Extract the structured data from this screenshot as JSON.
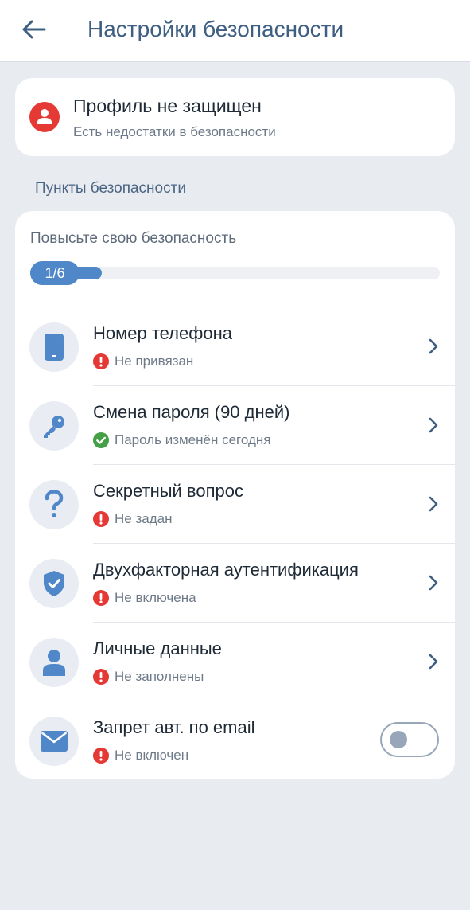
{
  "header": {
    "title": "Настройки безопасности",
    "back_icon": "arrow-left-icon"
  },
  "status_card": {
    "title": "Профиль не защищен",
    "subtitle": "Есть недостатки в безопасности",
    "icon": "user-alert-icon",
    "color": "#e53935"
  },
  "section": {
    "title": "Пункты безопасности"
  },
  "progress": {
    "caption": "Повысьте свою безопасность",
    "label": "1/6",
    "completed": 1,
    "total": 6
  },
  "items": [
    {
      "title": "Номер телефона",
      "status": "Не привязан",
      "state": "error",
      "icon": "phone-icon",
      "control": "chevron"
    },
    {
      "title": "Смена пароля (90 дней)",
      "status": "Пароль изменён сегодня",
      "state": "ok",
      "icon": "key-icon",
      "control": "chevron"
    },
    {
      "title": "Секретный вопрос",
      "status": "Не задан",
      "state": "error",
      "icon": "question-icon",
      "control": "chevron"
    },
    {
      "title": "Двухфакторная аутентификация",
      "status": "Не включена",
      "state": "error",
      "icon": "shield-check-icon",
      "control": "chevron"
    },
    {
      "title": "Личные данные",
      "status": "Не заполнены",
      "state": "error",
      "icon": "person-icon",
      "control": "chevron"
    },
    {
      "title": "Запрет авт. по email",
      "status": "Не включен",
      "state": "error",
      "icon": "mail-icon",
      "control": "toggle",
      "toggle_on": false
    }
  ],
  "colors": {
    "accent": "#4f87c9",
    "title": "#3e5f82",
    "error": "#e53935",
    "success": "#43a047",
    "background": "#e8ebf0"
  }
}
